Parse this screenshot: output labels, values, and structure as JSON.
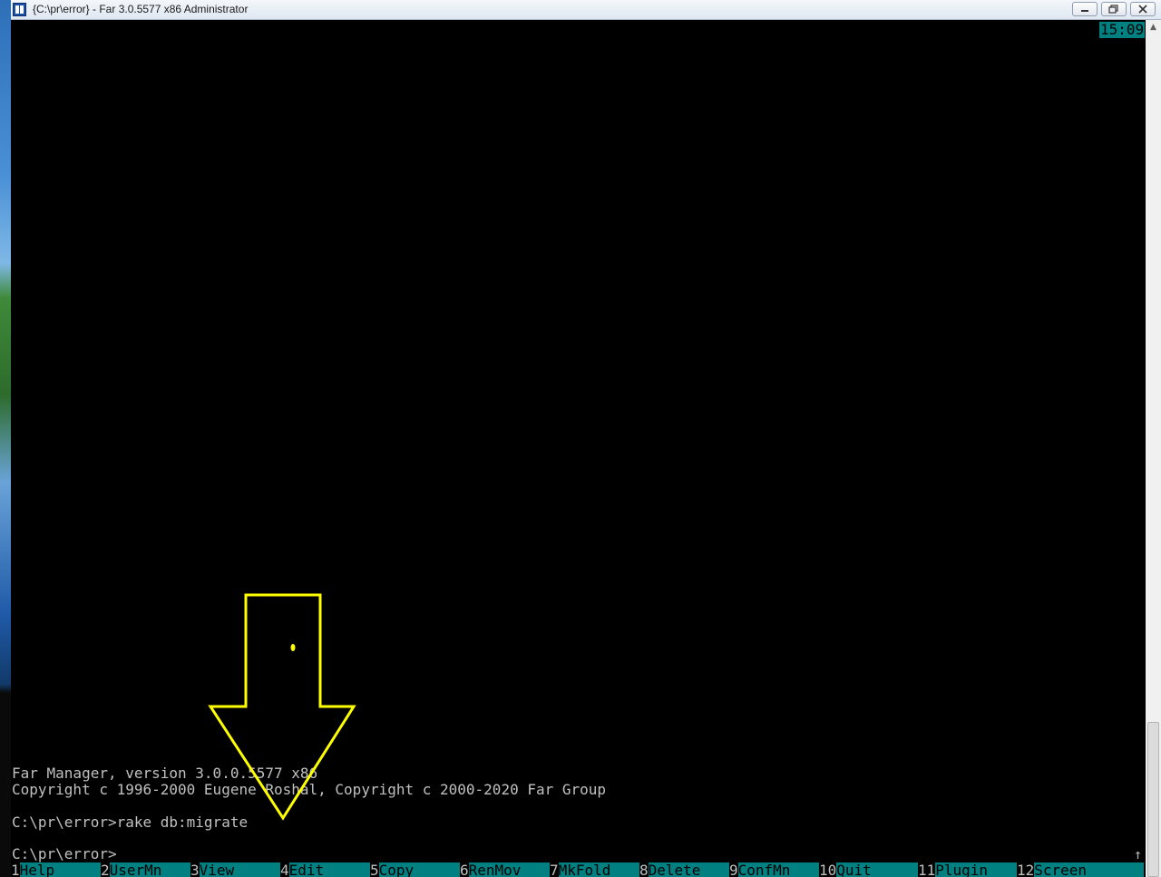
{
  "titlebar": {
    "title": "{C:\\pr\\error} - Far 3.0.5577 x86 Administrator",
    "min_icon": "minimize-icon",
    "max_icon": "restore-icon",
    "close_icon": "close-icon"
  },
  "clock": "15:09",
  "console": {
    "lines": [
      "Far Manager, version 3.0.0.5577 x86",
      "Copyright c 1996-2000 Eugene Roshal, Copyright c 2000-2020 Far Group",
      "C:\\pr\\error>rake db:migrate",
      "C:\\pr\\error>"
    ]
  },
  "annotation": {
    "type": "arrow-down",
    "color": "#ffff00"
  },
  "keybar": [
    {
      "num": "1",
      "label": "Help"
    },
    {
      "num": "2",
      "label": "UserMn"
    },
    {
      "num": "3",
      "label": "View"
    },
    {
      "num": "4",
      "label": "Edit"
    },
    {
      "num": "5",
      "label": "Copy"
    },
    {
      "num": "6",
      "label": "RenMov"
    },
    {
      "num": "7",
      "label": "MkFold"
    },
    {
      "num": "8",
      "label": "Delete"
    },
    {
      "num": "9",
      "label": "ConfMn"
    },
    {
      "num": "10",
      "label": "Quit"
    },
    {
      "num": "11",
      "label": "Plugin"
    },
    {
      "num": "12",
      "label": "Screen"
    }
  ],
  "colors": {
    "console_bg": "#000000",
    "console_text": "#c0c0c0",
    "keybar_bg": "#008080",
    "annotation": "#ffff00"
  }
}
